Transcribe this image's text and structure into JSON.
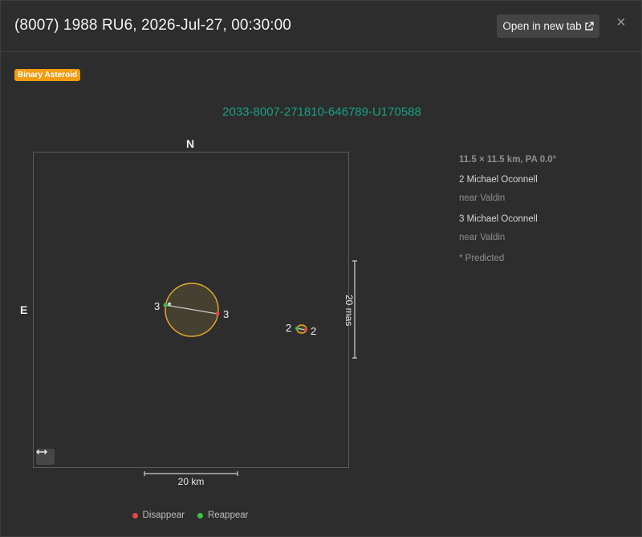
{
  "header": {
    "title": "(8007) 1988 RU6, 2026-Jul-27, 00:30:00",
    "open_button_label": "Open in new tab",
    "close_label": "×"
  },
  "badge": "Binary Asteroid",
  "event_id": "2033-8007-271810-646789-U170588",
  "plot": {
    "north_label": "N",
    "east_label": "E",
    "chords": [
      {
        "label_left": "3",
        "label_right": "3"
      },
      {
        "label_left": "2",
        "label_right": "2"
      }
    ],
    "predicted_marker": "*"
  },
  "scale": {
    "horizontal_label": "20 km",
    "vertical_label": "20 mas"
  },
  "legend": {
    "disappear": "Disappear",
    "reappear": "Reappear",
    "disappear_color": "#e04848",
    "reappear_color": "#3cc13c"
  },
  "info": {
    "size_text": "11.5 × 11.5 km, PA 0.0°",
    "observers": [
      {
        "name": "2 Michael Oconnell",
        "location": "near Valdin"
      },
      {
        "name": "3 Michael Oconnell",
        "location": "near Valdin"
      }
    ],
    "predicted_note": "* Predicted"
  },
  "colors": {
    "accent_green": "#17a382",
    "badge_orange": "#f39c12",
    "ellipse_stroke": "#e6ac2a"
  }
}
